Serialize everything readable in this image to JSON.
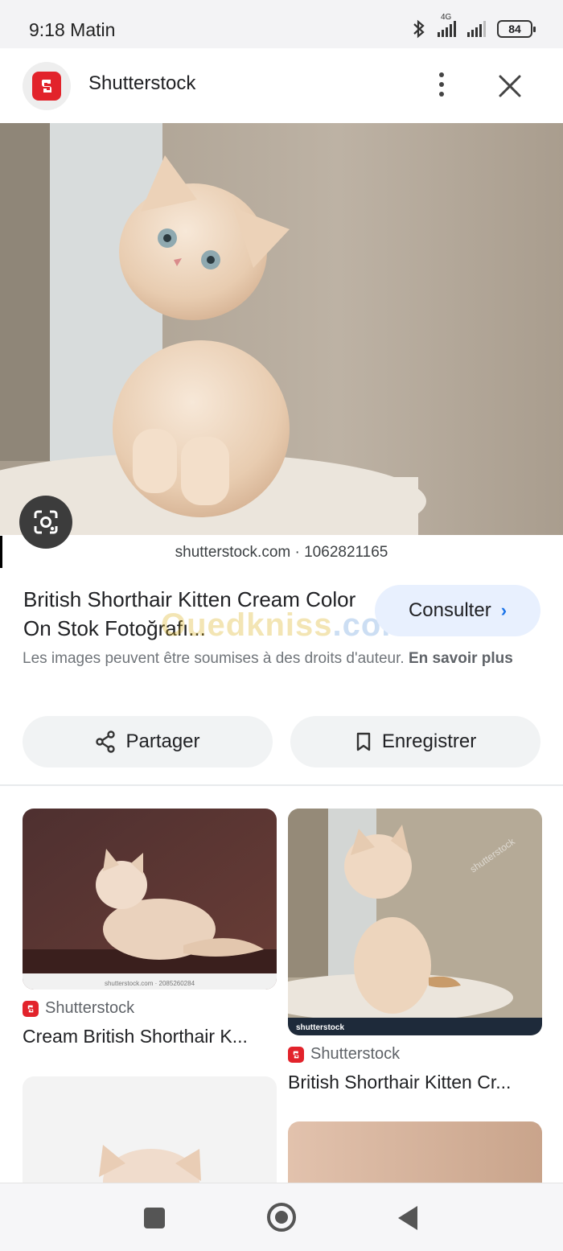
{
  "status_bar": {
    "time": "9:18 Matin",
    "network": "4G",
    "battery": "84"
  },
  "header": {
    "site_name": "Shutterstock",
    "logo_icon": "shutterstock-logo-icon",
    "more_icon": "more-vert-icon",
    "close_icon": "close-icon"
  },
  "hero": {
    "image_desc": "cream kitten",
    "caption": "shutterstock.com · 1062821165"
  },
  "result": {
    "title": "British Shorthair Kitten Cream Color On Stok Fotoğrafı...",
    "consult_label": "Consulter",
    "copyright_text": "Les images peuvent être soumises à des droits d'auteur.",
    "learn_more": "En savoir plus",
    "share_label": "Partager",
    "save_label": "Enregistrer"
  },
  "watermark": {
    "part1": "Ouedkniss",
    "part2": ".com"
  },
  "related": [
    {
      "source": "Shutterstock",
      "title": "Cream British Shorthair K...",
      "thumb_caption": "shutterstock.com · 2085260284"
    },
    {
      "source": "Shutterstock",
      "title": "British Shorthair Kitten Cr...",
      "thumb_caption": "shutterstock"
    }
  ],
  "colors": {
    "brand_red": "#e2232b",
    "accent_blue": "#1a73e8",
    "button_tint": "#e8f0fe"
  }
}
